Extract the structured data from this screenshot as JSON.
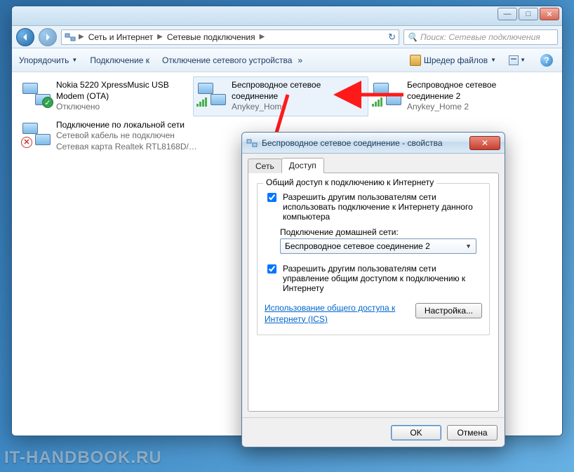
{
  "watermark": "IT-HANDBOOK.RU",
  "explorer": {
    "breadcrumb": [
      "Сеть и Интернет",
      "Сетевые подключения"
    ],
    "search_placeholder": "Поиск: Сетевые подключения",
    "win": {
      "min": "—",
      "max": "□",
      "close": "✕"
    }
  },
  "toolbar": {
    "organize": "Упорядочить",
    "connect": "Подключение к",
    "disable": "Отключение сетевого устройства",
    "shredder": "Шредер файлов",
    "raquo": "»"
  },
  "connections": [
    {
      "title": "Nokia 5220 XpressMusic USB Modem (OTA)",
      "line2": "Отключено",
      "line3": "",
      "type": "modem",
      "selected": false,
      "badge": "ok"
    },
    {
      "title": "Беспроводное сетевое соединение",
      "line2": "Anykey_Home",
      "line3": "",
      "type": "wifi",
      "selected": true,
      "badge": "signal"
    },
    {
      "title": "Беспроводное сетевое соединение 2",
      "line2": "Anykey_Home 2",
      "line3": "",
      "type": "wifi",
      "selected": false,
      "badge": "signal"
    },
    {
      "title": "Подключение по локальной сети",
      "line2": "Сетевой кабель не подключен",
      "line3": "Сетевая карта Realtek RTL8168D/…",
      "type": "lan",
      "selected": false,
      "badge": "x"
    }
  ],
  "dialog": {
    "title": "Беспроводное сетевое соединение - свойства",
    "tabs": {
      "network": "Сеть",
      "sharing": "Доступ"
    },
    "group_legend": "Общий доступ к подключению к Интернету",
    "cb1": "Разрешить другим пользователям сети использовать подключение к Интернету данного компьютера",
    "home_label": "Подключение домашней сети:",
    "combo_value": "Беспроводное сетевое соединение 2",
    "cb2": "Разрешить другим пользователям сети управление общим доступом к подключению к Интернету",
    "ics_link": "Использование общего доступа к Интернету (ICS)",
    "settings_btn": "Настройка...",
    "ok": "OK",
    "cancel": "Отмена",
    "close_glyph": "✕"
  }
}
